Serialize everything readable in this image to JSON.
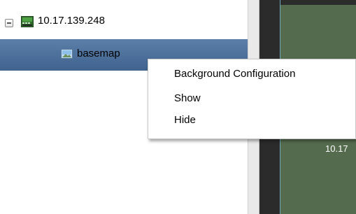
{
  "tree": {
    "root": {
      "label": "10.17.139.248",
      "icon": "device-icon",
      "expanded": true
    },
    "child": {
      "label": "basemap",
      "icon": "map-image-icon",
      "selected": true
    }
  },
  "context_menu": {
    "items": [
      {
        "label": "Background Configuration"
      },
      {
        "label": "Show"
      },
      {
        "label": "Hide"
      }
    ]
  },
  "map_view": {
    "label": "10.17"
  },
  "colors": {
    "selection": "#4a6e98",
    "map_background": "#556b4e",
    "canvas_background": "#2b2b2b"
  }
}
